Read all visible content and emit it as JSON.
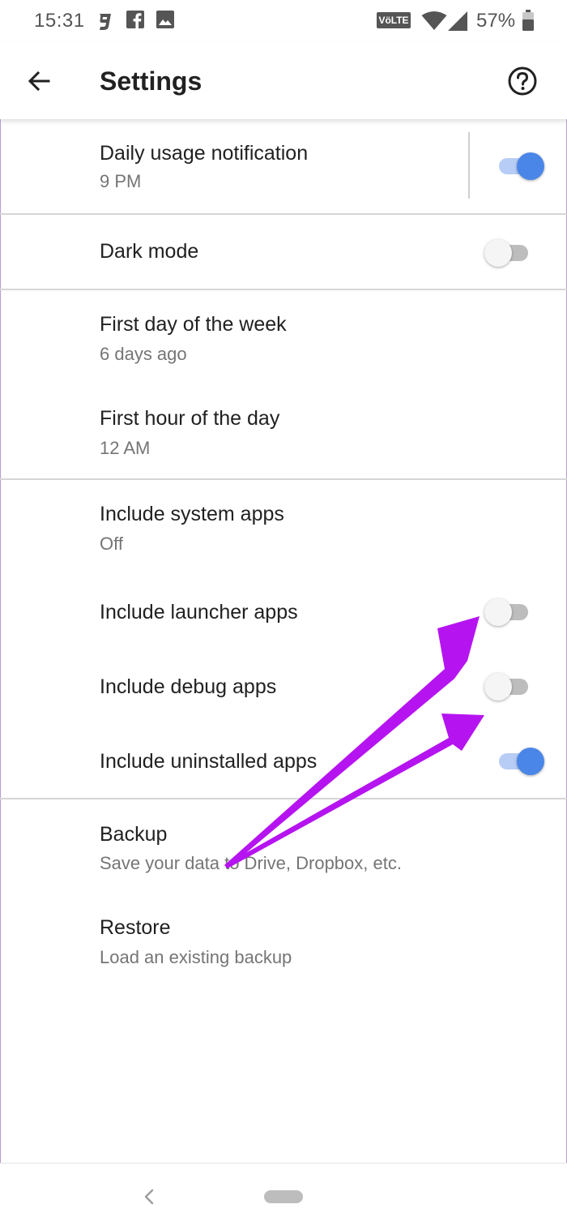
{
  "status_bar": {
    "time": "15:31",
    "notification_icons": [
      "g-app-icon",
      "facebook-icon",
      "image-icon"
    ],
    "volte_label": "VöLTE",
    "battery_percent": "57%"
  },
  "app_bar": {
    "title": "Settings",
    "back_icon": "arrow-back-icon",
    "help_icon": "help-circle-icon"
  },
  "settings": {
    "daily_usage": {
      "title": "Daily usage notification",
      "subtitle": "9 PM",
      "enabled": true
    },
    "dark_mode": {
      "title": "Dark mode",
      "enabled": false
    },
    "first_day": {
      "title": "First day of the week",
      "subtitle": "6 days ago"
    },
    "first_hour": {
      "title": "First hour of the day",
      "subtitle": "12 AM"
    },
    "system_apps": {
      "title": "Include system apps",
      "subtitle": "Off"
    },
    "launcher_apps": {
      "title": "Include launcher apps",
      "enabled": false
    },
    "debug_apps": {
      "title": "Include debug apps",
      "enabled": false
    },
    "uninstalled_apps": {
      "title": "Include uninstalled apps",
      "enabled": true
    },
    "backup": {
      "title": "Backup",
      "subtitle": "Save your data to Drive, Dropbox, etc."
    },
    "restore": {
      "title": "Restore",
      "subtitle": "Load an existing backup"
    }
  },
  "annotation": {
    "arrow_color": "#b514f0"
  },
  "colors": {
    "accent": "#4a86e8",
    "accent_track": "#b7cdf6",
    "divider": "#d6d6d6"
  }
}
